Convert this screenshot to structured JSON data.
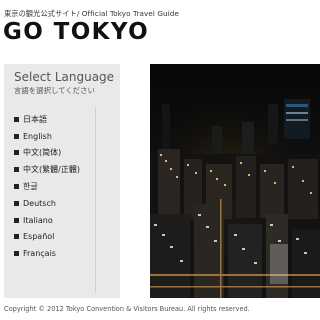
{
  "header": {
    "tagline": "東京の観光公式サイト/ Official Tokyo Travel Guide",
    "logo": "GO TOKYO"
  },
  "language_panel": {
    "title": "Select Language",
    "subtitle": "言語を選択してください",
    "items": [
      {
        "label": "日本語"
      },
      {
        "label": "English"
      },
      {
        "label": "中文(简体)"
      },
      {
        "label": "中文(繁體/正體)"
      },
      {
        "label": "한글"
      },
      {
        "label": "Deutsch"
      },
      {
        "label": "Italiano"
      },
      {
        "label": "Español"
      },
      {
        "label": "Français"
      }
    ]
  },
  "footer": {
    "copyright": "Copyright © 2012 Tokyo Convention & Visitors Bureau. All rights reserved."
  },
  "colors": {
    "panel_bg": "#e9e9e9",
    "photo_bg": "#0b0b0b",
    "text": "#222222"
  }
}
